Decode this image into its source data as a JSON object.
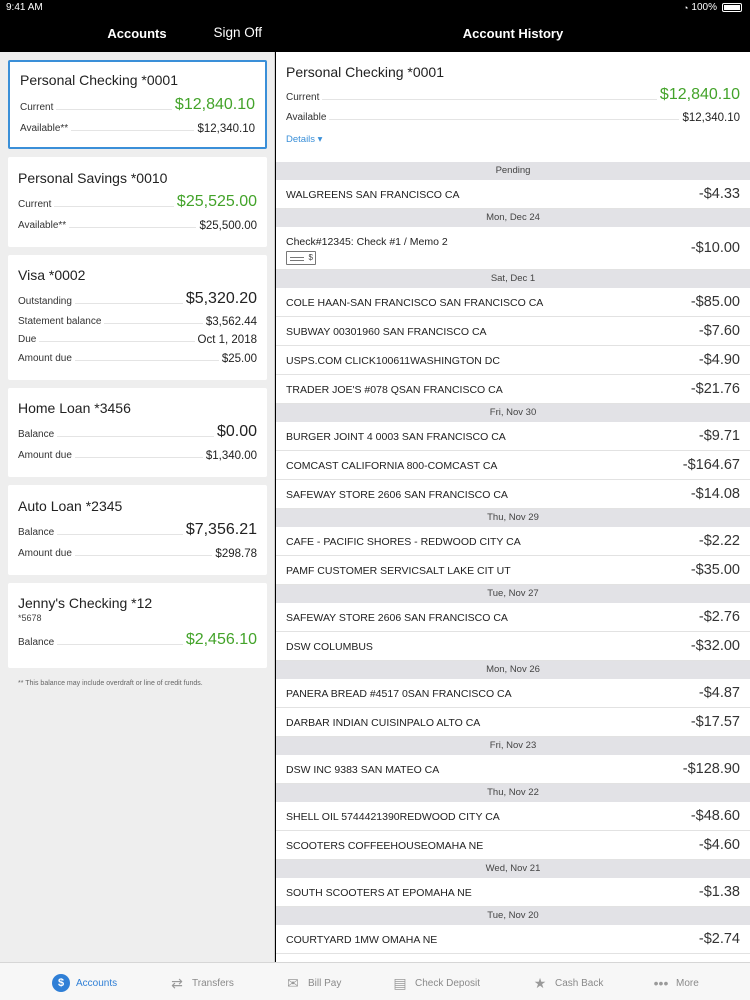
{
  "status": {
    "time": "9:41 AM",
    "battery": "100%"
  },
  "left_nav": {
    "title": "Accounts",
    "sign_off": "Sign Off"
  },
  "right_nav": {
    "title": "Account History"
  },
  "accounts": [
    {
      "name": "Personal Checking *0001",
      "rows": [
        {
          "label": "Current",
          "value": "$12,840.10"
        },
        {
          "label": "Available**",
          "value": "$12,340.10"
        }
      ]
    },
    {
      "name": "Personal Savings *0010",
      "rows": [
        {
          "label": "Current",
          "value": "$25,525.00"
        },
        {
          "label": "Available**",
          "value": "$25,500.00"
        }
      ]
    },
    {
      "name": "Visa *0002",
      "rows": [
        {
          "label": "Outstanding",
          "value": "$5,320.20"
        },
        {
          "label": "Statement balance",
          "value": "$3,562.44"
        },
        {
          "label": "Due",
          "value": "Oct 1, 2018"
        },
        {
          "label": "Amount due",
          "value": "$25.00"
        }
      ]
    },
    {
      "name": "Home Loan *3456",
      "rows": [
        {
          "label": "Balance",
          "value": "$0.00"
        },
        {
          "label": "Amount due",
          "value": "$1,340.00"
        }
      ]
    },
    {
      "name": "Auto Loan *2345",
      "rows": [
        {
          "label": "Balance",
          "value": "$7,356.21"
        },
        {
          "label": "Amount due",
          "value": "$298.78"
        }
      ]
    },
    {
      "name": "Jenny's Checking *12",
      "sub": "*5678",
      "rows": [
        {
          "label": "Balance",
          "value": "$2,456.10"
        }
      ]
    }
  ],
  "footnote": "** This balance may include overdraft or line of credit funds.",
  "detail": {
    "name": "Personal Checking *0001",
    "current_label": "Current",
    "current_value": "$12,840.10",
    "available_label": "Available",
    "available_value": "$12,340.10",
    "details_link": "Details ▾"
  },
  "transactions": [
    {
      "header": "Pending",
      "items": [
        {
          "desc": "WALGREENS SAN FRANCISCO CA",
          "amount": "-$4.33"
        }
      ]
    },
    {
      "header": "Mon, Dec 24",
      "items": [
        {
          "desc": "Check#12345: Check #1 / Memo 2",
          "amount": "-$10.00",
          "check": true
        }
      ]
    },
    {
      "header": "Sat, Dec 1",
      "items": [
        {
          "desc": "COLE HAAN-SAN FRANCISCO SAN FRANCISCO CA",
          "amount": "-$85.00"
        },
        {
          "desc": "SUBWAY 00301960 SAN FRANCISCO CA",
          "amount": "-$7.60"
        },
        {
          "desc": "USPS.COM CLICK100611WASHINGTON DC",
          "amount": "-$4.90"
        },
        {
          "desc": "TRADER JOE'S #078 QSAN FRANCISCO CA",
          "amount": "-$21.76"
        }
      ]
    },
    {
      "header": "Fri, Nov 30",
      "items": [
        {
          "desc": "BURGER JOINT 4 0003 SAN FRANCISCO CA",
          "amount": "-$9.71"
        },
        {
          "desc": "COMCAST CALIFORNIA 800-COMCAST CA",
          "amount": "-$164.67"
        },
        {
          "desc": "SAFEWAY STORE 2606 SAN FRANCISCO CA",
          "amount": "-$14.08"
        }
      ]
    },
    {
      "header": "Thu, Nov 29",
      "items": [
        {
          "desc": "CAFE - PACIFIC SHORES - REDWOOD CITY CA",
          "amount": "-$2.22"
        },
        {
          "desc": "PAMF CUSTOMER SERVICSALT LAKE CIT UT",
          "amount": "-$35.00"
        }
      ]
    },
    {
      "header": "Tue, Nov 27",
      "items": [
        {
          "desc": "SAFEWAY STORE 2606 SAN FRANCISCO CA",
          "amount": "-$2.76"
        },
        {
          "desc": "DSW COLUMBUS",
          "amount": "-$32.00"
        }
      ]
    },
    {
      "header": "Mon, Nov 26",
      "items": [
        {
          "desc": "PANERA BREAD #4517 0SAN FRANCISCO CA",
          "amount": "-$4.87"
        },
        {
          "desc": "DARBAR INDIAN CUISINPALO ALTO CA",
          "amount": "-$17.57"
        }
      ]
    },
    {
      "header": "Fri, Nov 23",
      "items": [
        {
          "desc": "DSW INC 9383 SAN MATEO CA",
          "amount": "-$128.90"
        }
      ]
    },
    {
      "header": "Thu, Nov 22",
      "items": [
        {
          "desc": "SHELL OIL 5744421390REDWOOD CITY CA",
          "amount": "-$48.60"
        },
        {
          "desc": "SCOOTERS COFFEEHOUSEOMAHA NE",
          "amount": "-$4.60"
        }
      ]
    },
    {
      "header": "Wed, Nov 21",
      "items": [
        {
          "desc": "SOUTH SCOOTERS AT EPOMAHA NE",
          "amount": "-$1.38"
        }
      ]
    },
    {
      "header": "Tue, Nov 20",
      "items": [
        {
          "desc": "COURTYARD 1MW OMAHA NE",
          "amount": "-$2.74"
        }
      ]
    }
  ],
  "tabs": [
    {
      "label": "Accounts",
      "icon": "dollar-circle-icon"
    },
    {
      "label": "Transfers",
      "icon": "transfer-arrows-icon"
    },
    {
      "label": "Bill Pay",
      "icon": "bill-pay-icon"
    },
    {
      "label": "Check Deposit",
      "icon": "check-deposit-icon"
    },
    {
      "label": "Cash Back",
      "icon": "star-icon"
    },
    {
      "label": "More",
      "icon": "more-dots-icon"
    }
  ],
  "colors": {
    "accent": "#2f7fd6",
    "positive": "#43a32a",
    "selection_border": "#3a8fd8"
  }
}
